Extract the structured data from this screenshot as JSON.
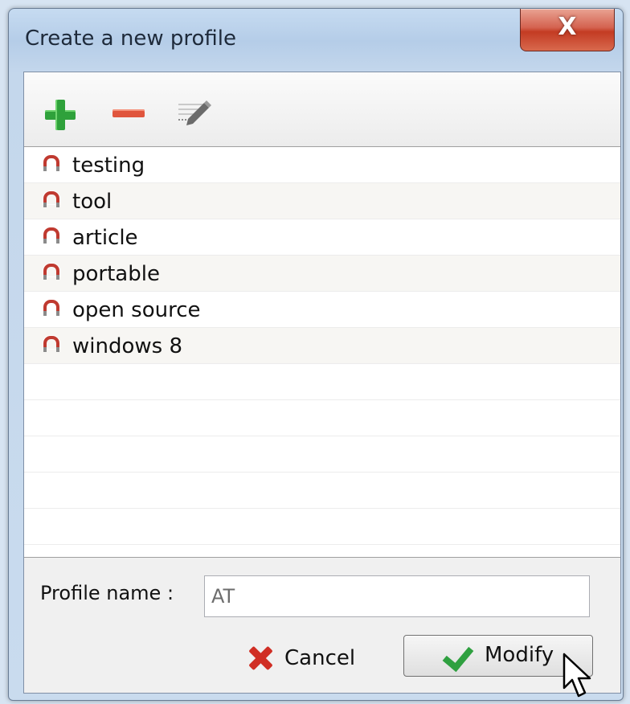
{
  "window": {
    "title": "Create a new profile",
    "close_label": "X"
  },
  "toolbar": {
    "add_icon": "plus-icon",
    "remove_icon": "minus-icon",
    "edit_icon": "edit-pen-icon"
  },
  "profiles": [
    {
      "label": "testing"
    },
    {
      "label": "tool"
    },
    {
      "label": "article"
    },
    {
      "label": "portable"
    },
    {
      "label": "open source"
    },
    {
      "label": "windows 8"
    }
  ],
  "form": {
    "profile_name_label": "Profile name :",
    "profile_name_value": "AT"
  },
  "buttons": {
    "cancel_label": "Cancel",
    "modify_label": "Modify"
  },
  "colors": {
    "accent_add": "#2fa13b",
    "accent_remove": "#e0553d",
    "close_red": "#c33b23",
    "profile_icon": "#c03a30"
  }
}
